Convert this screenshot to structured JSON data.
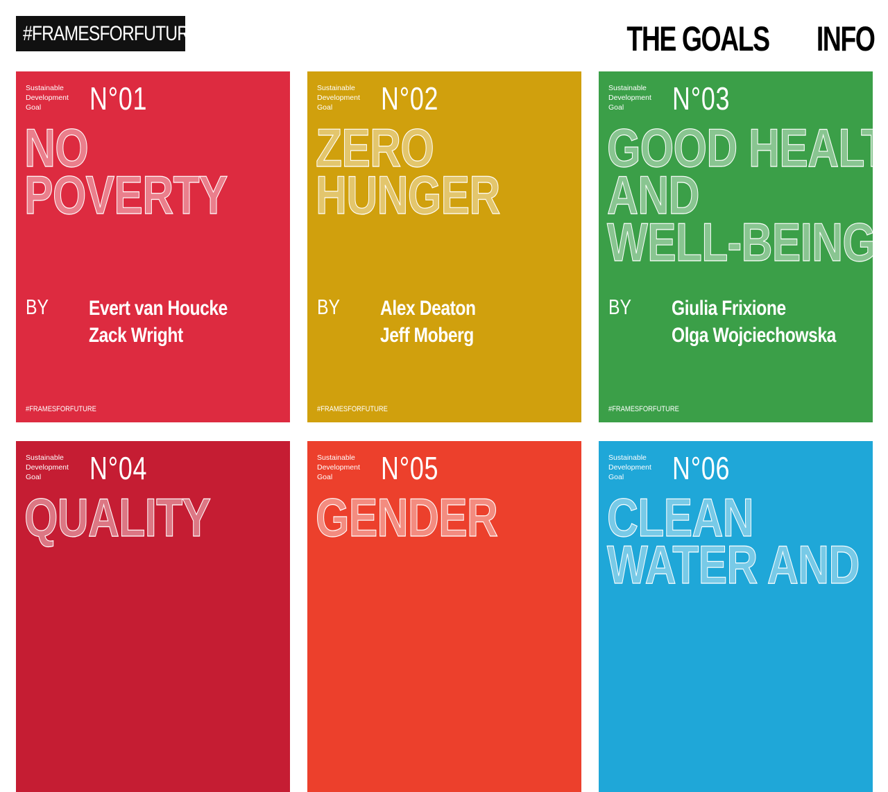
{
  "header": {
    "logo": "#FRAMESFORFUTURE",
    "nav": [
      {
        "label": "THE GOALS"
      },
      {
        "label": "INFO"
      }
    ]
  },
  "cards": [
    {
      "sdg": "Sustainable Development Goal",
      "num": "N°01",
      "title": [
        "NO",
        "POVERTY"
      ],
      "by": "BY",
      "authors": [
        "Evert van Houcke",
        "Zack Wright"
      ],
      "tag": "#FRAMESFORFUTURE",
      "color": "#dd2b40"
    },
    {
      "sdg": "Sustainable Development Goal",
      "num": "N°02",
      "title": [
        "ZERO",
        "HUNGER"
      ],
      "by": "BY",
      "authors": [
        "Alex Deaton",
        "Jeff Moberg"
      ],
      "tag": "#FRAMESFORFUTURE",
      "color": "#d0a00d"
    },
    {
      "sdg": "Sustainable Development Goal",
      "num": "N°03",
      "title": [
        "GOOD HEALTH",
        "AND",
        "WELL-BEING"
      ],
      "by": "BY",
      "authors": [
        "Giulia Frixione",
        "Olga Wojciechowska"
      ],
      "tag": "#FRAMESFORFUTURE",
      "color": "#3b9f48"
    },
    {
      "sdg": "Sustainable Development Goal",
      "num": "N°04",
      "title": [
        "QUALITY"
      ],
      "color": "#c51d33"
    },
    {
      "sdg": "Sustainable Development Goal",
      "num": "N°05",
      "title": [
        "GENDER"
      ],
      "color": "#ec402c"
    },
    {
      "sdg": "Sustainable Development Goal",
      "num": "N°06",
      "title": [
        "CLEAN",
        "WATER AND"
      ],
      "color": "#1fa7d8"
    }
  ]
}
